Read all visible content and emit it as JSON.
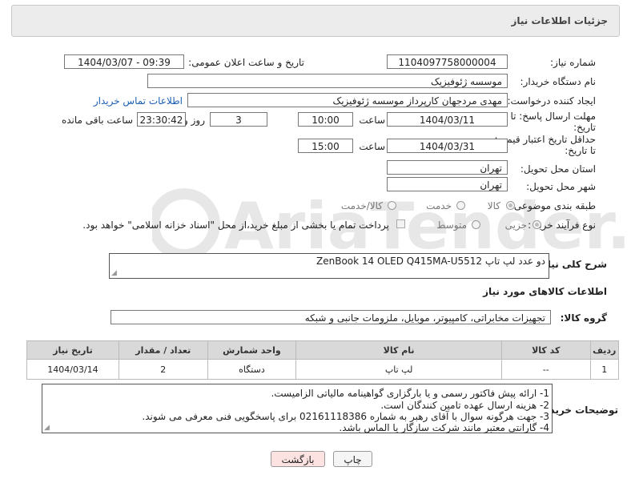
{
  "header": {
    "title": "جزئیات اطلاعات نیاز"
  },
  "form": {
    "need_number_label": "شماره نیاز:",
    "need_number": "1104097758000004",
    "announce_label": "تاریخ و ساعت اعلان عمومی:",
    "announce_value": "1404/03/07 - 09:39",
    "buyer_org_label": "نام دستگاه خریدار:",
    "buyer_org": "موسسه ژئوفیزیک",
    "requester_label": "ایجاد کننده درخواست:",
    "requester": "مهدی مردجهان کارپرداز موسسه ژئوفیزیک",
    "contact_link": "اطلاعات تماس خریدار",
    "deadline_label_1": "مهلت ارسال پاسخ: تا",
    "deadline_label_2": "تاریخ:",
    "deadline_date": "1404/03/11",
    "time_label": "ساعت",
    "deadline_time": "10:00",
    "days_value": "3",
    "days_label": "روز و",
    "remaining_time": "23:30:42",
    "remaining_label": "ساعت باقی مانده",
    "validity_label_1": "حداقل تاریخ اعتبار قیمت:",
    "validity_label_2": "تا تاریخ:",
    "validity_date": "1404/03/31",
    "validity_time_label": "ساعت",
    "validity_time": "15:00",
    "province_label": "استان محل تحویل:",
    "province": "تهران",
    "city_label": "شهر محل تحویل:",
    "city": "تهران",
    "category_label": "طبقه بندی موضوعی:",
    "category_options": [
      "کالا",
      "خدمت",
      "کالا/خدمت"
    ],
    "process_label": "نوع فرآیند خرید :",
    "process_options": [
      "جزیی",
      "متوسط"
    ],
    "payment_note": "پرداخت تمام یا بخشی از مبلغ خرید،از محل \"اسناد خزانه اسلامی\" خواهد بود.",
    "description_label": "شرح کلی نیاز:",
    "description": "دو عدد لپ تاپ ZenBook 14 OLED Q415MA-U5512"
  },
  "goods": {
    "section_title": "اطلاعات کالاهای مورد نیاز",
    "group_label": "گروه کالا:",
    "group_value": "تجهیزات مخابراتی، کامپیوتر، موبایل، ملزومات جانبی و شبکه",
    "columns": [
      "ردیف",
      "کد کالا",
      "نام کالا",
      "واحد شمارش",
      "تعداد / مقدار",
      "تاریخ نیاز"
    ],
    "rows": [
      {
        "row": "1",
        "code": "--",
        "name": "لپ تاپ",
        "unit": "دستگاه",
        "qty": "2",
        "date": "1404/03/14"
      }
    ]
  },
  "notes": {
    "label": "توضیحات خریدار:",
    "lines": [
      "1- ارائه پیش فاکتور رسمی و یا بارگزاری گواهینامه مالیاتی الزامیست.",
      "2- هزینه ارسال عهده تامین کنندگان است.",
      "3-  جهت هرگونه سوال با آقای رهبر به شماره 02161118386 برای پاسخگویی فنی معرفی می شوند.",
      "4- گارانتی معتبر مانند شرکت سازگار یا الماس باشد."
    ]
  },
  "buttons": {
    "print": "چاپ",
    "back": "بازگشت"
  },
  "watermark_text": "AriaTender.neT",
  "colors": {
    "link": "#1a5fb4",
    "back_button_bg": "#fde2e2",
    "header_bg": "#ececec"
  }
}
